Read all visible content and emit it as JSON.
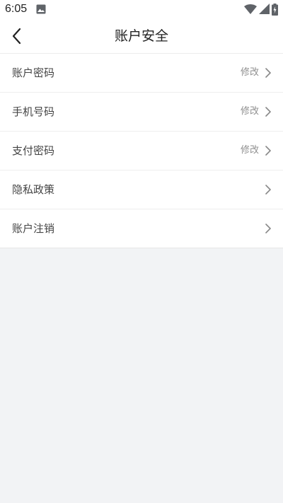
{
  "status_bar": {
    "time": "6:05",
    "icons": [
      "image-icon",
      "wifi-icon",
      "signal-icon",
      "battery-charging-icon"
    ]
  },
  "header": {
    "title": "账户安全",
    "back_icon": "chevron-left-icon"
  },
  "settings": {
    "items": [
      {
        "label": "账户密码",
        "action": "修改"
      },
      {
        "label": "手机号码",
        "action": "修改"
      },
      {
        "label": "支付密码",
        "action": "修改"
      },
      {
        "label": "隐私政策",
        "action": ""
      },
      {
        "label": "账户注销",
        "action": ""
      }
    ],
    "chevron_icon": "chevron-right-icon"
  },
  "colors": {
    "page_background": "#f2f3f5",
    "row_background": "#ffffff",
    "label_text": "#444444",
    "action_text": "#8f8f8f",
    "chevron": "#888888"
  }
}
